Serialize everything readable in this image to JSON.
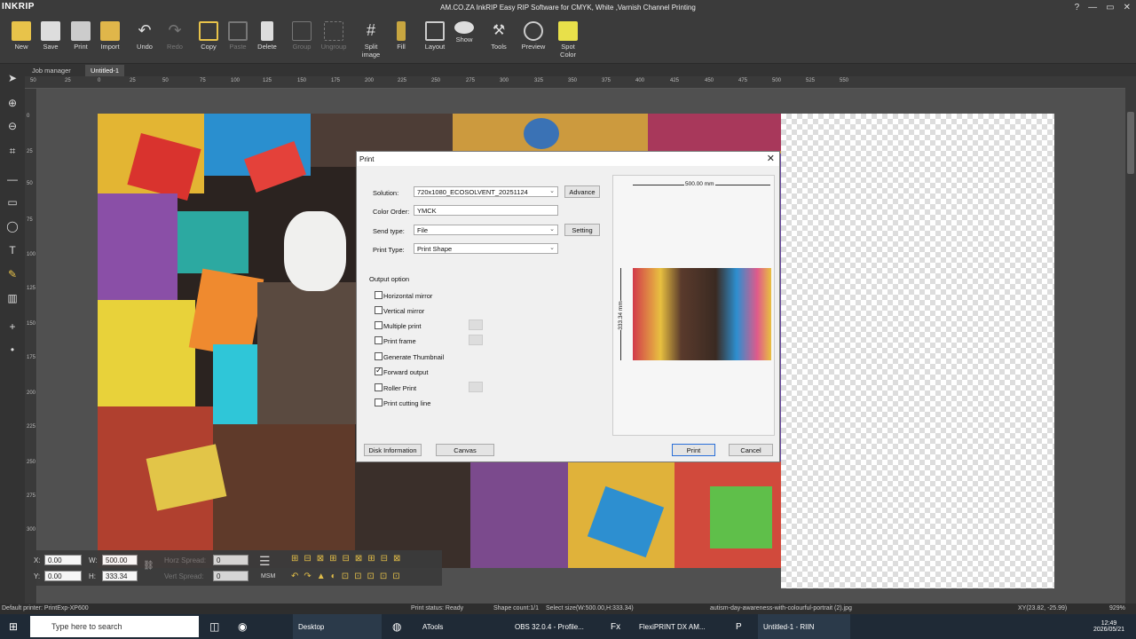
{
  "app": {
    "logo": "INKRIP",
    "title": "AM.CO.ZA InkRIP Easy RIP Software for CMYK, White ,Varnish Channel Printing"
  },
  "toolbar": [
    {
      "label": "New",
      "icon": "new-icon",
      "enabled": true
    },
    {
      "label": "Save",
      "icon": "save-icon",
      "enabled": true
    },
    {
      "label": "Print",
      "icon": "print-icon",
      "enabled": true
    },
    {
      "label": "Import",
      "icon": "import-icon",
      "enabled": true
    },
    {
      "label": "Undo",
      "icon": "undo-icon",
      "enabled": true
    },
    {
      "label": "Redo",
      "icon": "redo-icon",
      "enabled": false
    },
    {
      "label": "Copy",
      "icon": "copy-icon",
      "enabled": true
    },
    {
      "label": "Paste",
      "icon": "paste-icon",
      "enabled": false
    },
    {
      "label": "Delete",
      "icon": "delete-icon",
      "enabled": true
    },
    {
      "label": "Group",
      "icon": "group-icon",
      "enabled": false
    },
    {
      "label": "Ungroup",
      "icon": "ungroup-icon",
      "enabled": false
    },
    {
      "label": "Split image",
      "icon": "split-image-icon",
      "enabled": true
    },
    {
      "label": "Fill",
      "icon": "fill-icon",
      "enabled": true
    },
    {
      "label": "Layout",
      "icon": "layout-icon",
      "enabled": true
    },
    {
      "label": "Show",
      "icon": "show-icon",
      "enabled": true
    },
    {
      "label": "Tools",
      "icon": "tools-icon",
      "enabled": true
    },
    {
      "label": "Preview",
      "icon": "preview-icon",
      "enabled": true
    },
    {
      "label": "Spot Color",
      "icon": "spot-color-icon",
      "enabled": true
    }
  ],
  "tabs": [
    {
      "label": "Job manager"
    },
    {
      "label": "Untitled-1"
    }
  ],
  "ruler_h": [
    "50",
    "25",
    "0",
    "25",
    "50",
    "75",
    "100",
    "125",
    "150",
    "175",
    "200",
    "225",
    "250",
    "275",
    "300",
    "325",
    "350",
    "375",
    "400",
    "425",
    "450",
    "475",
    "500",
    "525",
    "550"
  ],
  "ruler_v": [
    "0",
    "25",
    "50",
    "75",
    "100",
    "125",
    "150",
    "175",
    "200",
    "225",
    "250",
    "275",
    "300"
  ],
  "dialog": {
    "title": "Print",
    "solution_label": "Solution:",
    "solution_value": "720x1080_ECOSOLVENT_20251124",
    "advance_btn": "Advance",
    "color_order_label": "Color Order:",
    "color_order_value": "YMCK",
    "send_type_label": "Send type:",
    "send_type_value": "File",
    "setting_btn": "Setting",
    "print_type_label": "Print Type:",
    "print_type_value": "Print Shape",
    "output_option_label": "Output option",
    "options": [
      {
        "label": "Horizontal mirror",
        "checked": false
      },
      {
        "label": "Vertical mirror",
        "checked": false
      },
      {
        "label": "Multiple print",
        "checked": false
      },
      {
        "label": "Print frame",
        "checked": false
      },
      {
        "label": "Generate Thumbnail",
        "checked": false
      },
      {
        "label": "Forward output",
        "checked": true
      },
      {
        "label": "Roller Print",
        "checked": false
      },
      {
        "label": "Print cutting line",
        "checked": false
      }
    ],
    "width_dim": "500.00 mm",
    "height_dim": "333.34 mm",
    "disk_info_btn": "Disk Information",
    "canvas_btn": "Canvas",
    "print_btn": "Print",
    "cancel_btn": "Cancel"
  },
  "fields": {
    "x_label": "X:",
    "x": "0.00",
    "y_label": "Y:",
    "y": "0.00",
    "w_label": "W:",
    "w": "500.00",
    "h_label": "H:",
    "h": "333.34",
    "horz_spread_label": "Horz Spread:",
    "horz_spread": "0",
    "vert_spread_label": "Vert Spread:",
    "vert_spread": "0",
    "msm": "MSM"
  },
  "status": {
    "printer": "Default printer: PrintExp-XP600",
    "print_status": "Print status: Ready",
    "shape_count": "Shape count:1/1",
    "select_size": "Select size(W:500.00,H:333.34)",
    "filename": "autism-day-awareness-with-colourful-portrait (2).jpg",
    "xy": "XY(23.82, -25.99)",
    "zoom": "929%"
  },
  "taskbar": {
    "search_placeholder": "Type here to search",
    "items": [
      "Desktop",
      "ATools",
      "OBS 32.0.4 - Profile...",
      "FlexiPRINT DX AM...",
      "Untitled-1 - RIIN"
    ],
    "time": "12:49",
    "date": "2026/05/21"
  },
  "colors": {
    "accent": "#2a6fd8",
    "toolbar_bg": "#3b3b3b",
    "canvas_bg": "#505050"
  }
}
